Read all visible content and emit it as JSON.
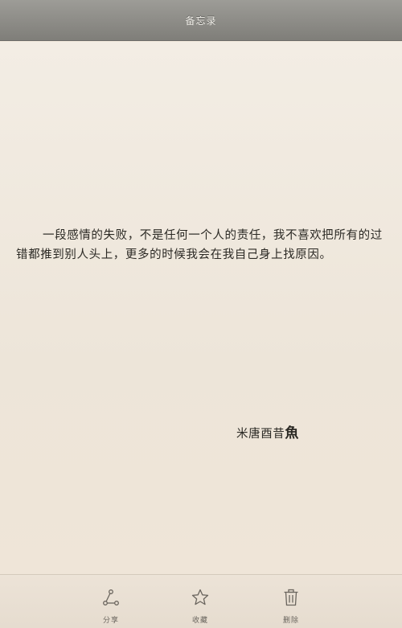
{
  "nav": {
    "title": "备忘录"
  },
  "note": {
    "body": "一段感情的失败，不是任何一个人的责任，我不喜欢把所有的过错都推到别人头上，更多的时候我会在我自己身上找原因。",
    "signature_main": "米唐酉昔",
    "signature_last": "魚"
  },
  "toolbar": {
    "share_label": "分享",
    "favorite_label": "收藏",
    "delete_label": "删除"
  },
  "colors": {
    "nav_bar": "#8e8d88",
    "paper": "#efe6da",
    "text": "#2b2924",
    "icon": "#6a655e"
  },
  "icons": {
    "share": "share-nodes-icon",
    "favorite": "star-icon",
    "delete": "trash-icon"
  }
}
